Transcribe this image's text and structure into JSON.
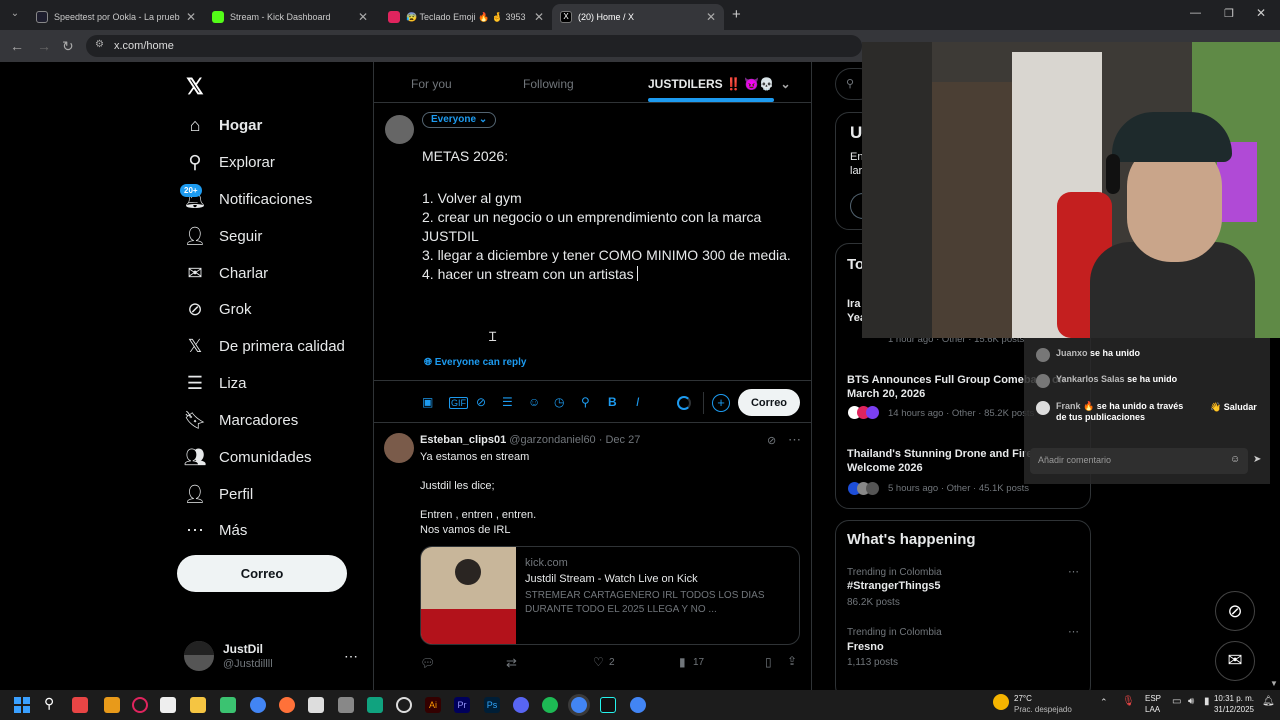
{
  "browser": {
    "tabs": [
      {
        "title": "Speedtest por Ookla - La prueba d",
        "color": "#1e1e2e"
      },
      {
        "title": "Stream - Kick Dashboard",
        "color": "#53fc18"
      },
      {
        "title": "😰 Teclado Emoji 🔥 🤞 3953",
        "color": "#e0245e"
      },
      {
        "title": "(20) Home / X",
        "color": "#000000"
      }
    ],
    "url": "x.com/home"
  },
  "nav": {
    "items": [
      {
        "label": "Hogar",
        "icon": "home-icon",
        "glyph": "⌂"
      },
      {
        "label": "Explorar",
        "icon": "search-icon",
        "glyph": "⚲"
      },
      {
        "label": "Notificaciones",
        "icon": "bell-icon",
        "glyph": "🔔"
      },
      {
        "label": "Seguir",
        "icon": "follow-icon",
        "glyph": "👤"
      },
      {
        "label": "Charlar",
        "icon": "mail-icon",
        "glyph": "✉"
      },
      {
        "label": "Grok",
        "icon": "grok-icon",
        "glyph": "⊘"
      },
      {
        "label": "De primera calidad",
        "icon": "x-premium-icon",
        "glyph": "𝕏"
      },
      {
        "label": "Liza",
        "icon": "list-icon",
        "glyph": "☰"
      },
      {
        "label": "Marcadores",
        "icon": "bookmark-icon",
        "glyph": "🔖"
      },
      {
        "label": "Comunidades",
        "icon": "communities-icon",
        "glyph": "👥"
      },
      {
        "label": "Perfil",
        "icon": "profile-icon",
        "glyph": "👤"
      },
      {
        "label": "Más",
        "icon": "more-icon",
        "glyph": "⋯"
      }
    ],
    "notif_badge": "20+",
    "post_button": "Correo",
    "account_name": "JustDil",
    "account_handle": "@Justdillll"
  },
  "main": {
    "tabs": [
      "For you",
      "Following",
      "JUSTDILERS ‼️ 😈💀"
    ],
    "audience": "Everyone",
    "compose_lines": [
      "METAS 2026:",
      "",
      "1. Volver al gym",
      "2. crear un negocio o un emprendimiento con la marca JUSTDIL",
      "3. llegar a diciembre y tener COMO MINIMO 300 de media.",
      "4. hacer un stream con un artistas"
    ],
    "reply_setting": "Everyone can reply",
    "post_button": "Correo",
    "tweet": {
      "name": "Esteban_clips01",
      "handle": "@garzondaniel60",
      "date": "· Dec 27",
      "lines": [
        "Ya estamos en stream",
        "Justdil les dice;",
        "Entren , entren , entren.",
        "Nos vamos de IRL"
      ],
      "link_domain": "kick.com",
      "link_title": "Justdil Stream - Watch Live on Kick",
      "link_desc": "STREMEAR CARTAGENERO IRL TODOS LOS DIAS DURANTE TODO EL 2025 LLEGA Y NO ...",
      "likes": "2",
      "views": "17"
    }
  },
  "right": {
    "news": [
      {
        "title": "Ira... Yea...",
        "meta": "1 hour ago · Other · 15.6K posts"
      },
      {
        "title": "BTS Announces Full Group Comeback on March 20, 2026",
        "meta": "14 hours ago · Other · 85.2K posts"
      },
      {
        "title": "Thailand's Stunning Drone and Fireworks Welcome 2026",
        "meta": "5 hours ago · Other · 45.1K posts"
      }
    ],
    "whats_happening": "What's happening",
    "trends": [
      {
        "context": "Trending in Colombia",
        "name": "#StrangerThings5",
        "count": "86.2K posts"
      },
      {
        "context": "Trending in Colombia",
        "name": "Fresno",
        "count": "1,113 posts"
      }
    ],
    "partial_u": "U",
    "partial_en": "En",
    "partial_lar": "lar",
    "partial_to": "To"
  },
  "stream_chat": {
    "messages": [
      {
        "user": "Juanxo",
        "text": "se ha unido"
      },
      {
        "user": "Yankarlos Salas",
        "text": "se ha unido"
      },
      {
        "user": "Frank 🔥",
        "text": "se ha unido a través de tus publicaciones"
      }
    ],
    "greet": "Saludar",
    "placeholder": "Añadir comentario"
  },
  "taskbar": {
    "weather_temp": "27°C",
    "weather_desc": "Prac. despejado",
    "lang": "ESP",
    "lang2": "LAA",
    "time": "10:31 p. m.",
    "date": "31/12/2025"
  }
}
